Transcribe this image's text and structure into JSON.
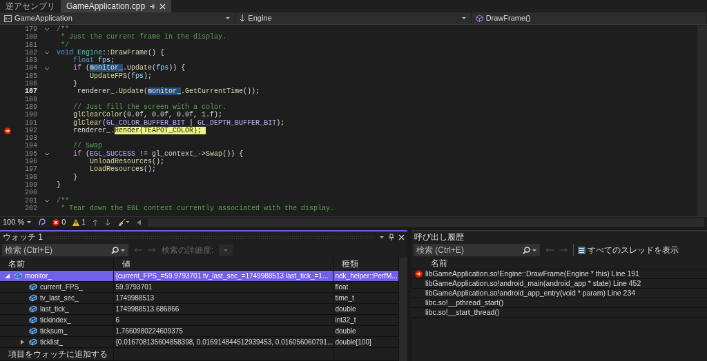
{
  "tabs": [
    {
      "label": "逆アセンブリ",
      "selected": false
    },
    {
      "label": "GameApplication.cpp",
      "selected": true
    }
  ],
  "navigation": {
    "project": "GameApplication",
    "scope": "Engine",
    "member": "DrawFrame()"
  },
  "code": [
    {
      "number": "179",
      "fold": true,
      "current": false,
      "execution_point": false,
      "tokens": [
        {
          "kind": "comment",
          "text": "/**"
        }
      ]
    },
    {
      "number": "180",
      "fold": false,
      "current": false,
      "execution_point": false,
      "tokens": [
        {
          "kind": "comment",
          "text": " * Just the current frame in the display."
        }
      ]
    },
    {
      "number": "181",
      "fold": false,
      "current": false,
      "execution_point": false,
      "tokens": [
        {
          "kind": "comment",
          "text": " */"
        }
      ]
    },
    {
      "number": "182",
      "fold": true,
      "current": false,
      "execution_point": false,
      "tokens": [
        {
          "kind": "keyword",
          "text": "void "
        },
        {
          "kind": "type",
          "text": "Engine"
        },
        {
          "kind": "plain",
          "text": "::"
        },
        {
          "kind": "function",
          "text": "DrawFrame"
        },
        {
          "kind": "plain",
          "text": "() {"
        }
      ]
    },
    {
      "number": "183",
      "fold": false,
      "current": false,
      "execution_point": false,
      "tokens": [
        {
          "kind": "keyword",
          "text": "    float "
        },
        {
          "kind": "variable",
          "text": "fps"
        },
        {
          "kind": "plain",
          "text": ";"
        }
      ]
    },
    {
      "number": "184",
      "fold": true,
      "current": false,
      "execution_point": false,
      "tokens": [
        {
          "kind": "control",
          "text": "    if"
        },
        {
          "kind": "plain",
          "text": " ("
        },
        {
          "kind": "reference",
          "text": "monitor_"
        },
        {
          "kind": "plain",
          "text": "."
        },
        {
          "kind": "function",
          "text": "Update"
        },
        {
          "kind": "plain",
          "text": "("
        },
        {
          "kind": "variable",
          "text": "fps"
        },
        {
          "kind": "plain",
          "text": ")) {"
        }
      ]
    },
    {
      "number": "185",
      "fold": false,
      "current": false,
      "execution_point": false,
      "tokens": [
        {
          "kind": "function",
          "text": "        UpdateFPS"
        },
        {
          "kind": "plain",
          "text": "("
        },
        {
          "kind": "variable",
          "text": "fps"
        },
        {
          "kind": "plain",
          "text": ");"
        }
      ]
    },
    {
      "number": "186",
      "fold": false,
      "current": false,
      "execution_point": false,
      "tokens": [
        {
          "kind": "plain",
          "text": "    }"
        }
      ]
    },
    {
      "number": "187",
      "fold": false,
      "current": true,
      "execution_point": false,
      "tokens": [
        {
          "kind": "plain",
          "text": "     renderer_."
        },
        {
          "kind": "function",
          "text": "Update"
        },
        {
          "kind": "plain",
          "text": "("
        },
        {
          "kind": "reference",
          "text": "monitor_"
        },
        {
          "kind": "plain",
          "text": "."
        },
        {
          "kind": "function",
          "text": "GetCurrentTime"
        },
        {
          "kind": "plain",
          "text": "());"
        }
      ]
    },
    {
      "number": "188",
      "fold": false,
      "current": false,
      "execution_point": false
    },
    {
      "number": "189",
      "fold": false,
      "current": false,
      "execution_point": false,
      "tokens": [
        {
          "kind": "comment",
          "text": "    // Just fill the screen with a color."
        }
      ]
    },
    {
      "number": "190",
      "fold": false,
      "current": false,
      "execution_point": false,
      "tokens": [
        {
          "kind": "function",
          "text": "    glClearColor"
        },
        {
          "kind": "plain",
          "text": "(0.0f, 0.0f, 0.0f, 1.f);"
        }
      ]
    },
    {
      "number": "191",
      "fold": false,
      "current": false,
      "execution_point": false,
      "tokens": [
        {
          "kind": "function",
          "text": "    glClear"
        },
        {
          "kind": "plain",
          "text": "("
        },
        {
          "kind": "macro",
          "text": "GL_COLOR_BUFFER_BIT"
        },
        {
          "kind": "plain",
          "text": " | "
        },
        {
          "kind": "macro",
          "text": "GL_DEPTH_BUFFER_BIT"
        },
        {
          "kind": "plain",
          "text": ");"
        }
      ]
    },
    {
      "number": "192",
      "fold": false,
      "current": false,
      "execution_point": true,
      "tokens": [
        {
          "kind": "plain",
          "text": "    renderer_."
        },
        {
          "kind": "statement",
          "text": "Render(TEAPOT_COLOR); "
        }
      ]
    },
    {
      "number": "193",
      "fold": false,
      "current": false,
      "execution_point": false
    },
    {
      "number": "194",
      "fold": false,
      "current": false,
      "execution_point": false,
      "tokens": [
        {
          "kind": "comment",
          "text": "    // Swap"
        }
      ]
    },
    {
      "number": "195",
      "fold": true,
      "current": false,
      "execution_point": false,
      "tokens": [
        {
          "kind": "control",
          "text": "    if"
        },
        {
          "kind": "plain",
          "text": " ("
        },
        {
          "kind": "macro",
          "text": "EGL_SUCCESS"
        },
        {
          "kind": "plain",
          "text": " != gl_context_->"
        },
        {
          "kind": "function",
          "text": "Swap"
        },
        {
          "kind": "plain",
          "text": "()) {"
        }
      ]
    },
    {
      "number": "196",
      "fold": false,
      "current": false,
      "execution_point": false,
      "tokens": [
        {
          "kind": "function",
          "text": "        UnloadResources"
        },
        {
          "kind": "plain",
          "text": "();"
        }
      ]
    },
    {
      "number": "197",
      "fold": false,
      "current": false,
      "execution_point": false,
      "tokens": [
        {
          "kind": "function",
          "text": "        LoadResources"
        },
        {
          "kind": "plain",
          "text": "();"
        }
      ]
    },
    {
      "number": "198",
      "fold": false,
      "current": false,
      "execution_point": false,
      "tokens": [
        {
          "kind": "plain",
          "text": "    }"
        }
      ]
    },
    {
      "number": "199",
      "fold": false,
      "current": false,
      "execution_point": false,
      "tokens": [
        {
          "kind": "plain",
          "text": "}"
        }
      ]
    },
    {
      "number": "200",
      "fold": false,
      "current": false,
      "execution_point": false
    },
    {
      "number": "201",
      "fold": true,
      "current": false,
      "execution_point": false,
      "tokens": [
        {
          "kind": "comment",
          "text": "/**"
        }
      ]
    },
    {
      "number": "202",
      "fold": false,
      "current": false,
      "execution_point": false,
      "tokens": [
        {
          "kind": "comment",
          "text": " * Tear down the EGL context currently associated with the display."
        }
      ]
    }
  ],
  "status_bar": {
    "zoom": "100 %",
    "errors": "0",
    "warnings": "1"
  },
  "watch": {
    "title": "ウォッチ 1",
    "search": {
      "placeholder": "検索 (Ctrl+E)"
    },
    "depth_label": "検索の詳細度:",
    "columns": [
      "名前",
      "値",
      "種類"
    ],
    "rows": [
      {
        "name": "monitor_",
        "value": "{current_FPS_=59.9793701 tv_last_sec_=1749988513 last_tick_=1...",
        "type": "ndk_helper::PerfM...",
        "selected": true,
        "expanded": true,
        "children": [
          {
            "name": "current_FPS_",
            "value": "59.9793701",
            "type": "float",
            "selected": false,
            "expandable": false
          },
          {
            "name": "tv_last_sec_",
            "value": "1749988513",
            "type": "time_t",
            "selected": false,
            "expandable": false
          },
          {
            "name": "last_tick_",
            "value": "1749988513.686866",
            "type": "double",
            "selected": false,
            "expandable": false
          },
          {
            "name": "tickindex_",
            "value": "6",
            "type": "int32_t",
            "selected": false,
            "expandable": false
          },
          {
            "name": "ticksum_",
            "value": "1.7660980224609375",
            "type": "double",
            "selected": false,
            "expandable": false
          },
          {
            "name": "ticklist_",
            "value": "{0.016708135604858398, 0.016914844512939453, 0.016056060791...",
            "type": "double[100]",
            "selected": false,
            "expandable": true,
            "expanded": false
          }
        ]
      }
    ],
    "add_item": "項目をウォッチに追加する"
  },
  "call_stack": {
    "title": "呼び出し履歴",
    "search": {
      "placeholder": "検索 (Ctrl+E)"
    },
    "show_threads": "すべてのスレッドを表示",
    "columns": [
      "名前"
    ],
    "frames": [
      {
        "name": "libGameApplication.so!Engine::DrawFrame(Engine * this) Line 191",
        "current": true
      },
      {
        "name": "libGameApplication.so!android_main(android_app * state) Line 452",
        "current": false
      },
      {
        "name": "libGameApplication.so!android_app_entry(void * param) Line 234",
        "current": false
      },
      {
        "name": "libc.so!__pthread_start()",
        "current": false
      },
      {
        "name": "libc.so!__start_thread()",
        "current": false
      }
    ]
  }
}
